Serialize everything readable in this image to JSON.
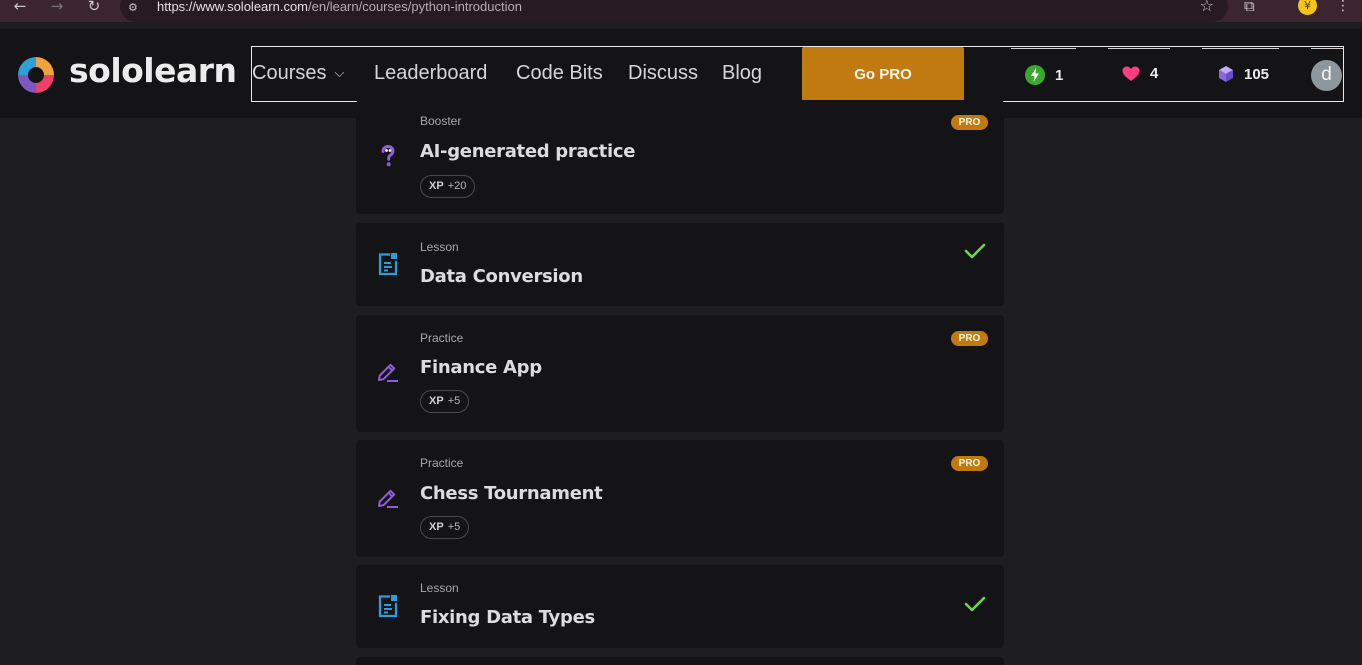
{
  "browser": {
    "url_prefix": "https://www.sololearn.com",
    "url_path": "/en/learn/courses/python-introduction",
    "back_icon": "arrow-left-icon",
    "forward_icon": "arrow-right-icon",
    "reload_icon": "reload-icon",
    "site_info_icon": "tune-icon",
    "bookmark_icon": "star-icon",
    "extensions_icon": "puzzle-icon",
    "profile_icon": "profile-icon",
    "menu_icon": "kebab-menu-icon"
  },
  "header": {
    "logo_text": "sololearn",
    "nav": [
      {
        "label": "Courses"
      },
      {
        "label": "Leaderboard"
      },
      {
        "label": "Code Bits"
      },
      {
        "label": "Discuss"
      },
      {
        "label": "Blog"
      }
    ],
    "go_pro_label": "Go PRO",
    "stats": {
      "streak": "1",
      "hearts": "4",
      "bits": "105"
    },
    "avatar_letter": "d",
    "colors": {
      "go_pro": "#c07a0f",
      "streak": "#3aa82e",
      "heart": "#ff3d7f",
      "bits": "#9a79e3"
    }
  },
  "lessons": [
    {
      "type": "Booster",
      "title": "AI-generated practice",
      "xp_label": "XP",
      "xp_value": "+20",
      "pro": "PRO",
      "icon": "question-mark-icon"
    },
    {
      "type": "Lesson",
      "title": "Data Conversion",
      "icon": "lesson-doc-icon",
      "completed": true
    },
    {
      "type": "Practice",
      "title": "Finance App",
      "xp_label": "XP",
      "xp_value": "+5",
      "pro": "PRO",
      "icon": "pencil-icon"
    },
    {
      "type": "Practice",
      "title": "Chess Tournament",
      "xp_label": "XP",
      "xp_value": "+5",
      "pro": "PRO",
      "icon": "pencil-icon"
    },
    {
      "type": "Lesson",
      "title": "Fixing Data Types",
      "icon": "lesson-doc-icon",
      "completed": true
    }
  ]
}
